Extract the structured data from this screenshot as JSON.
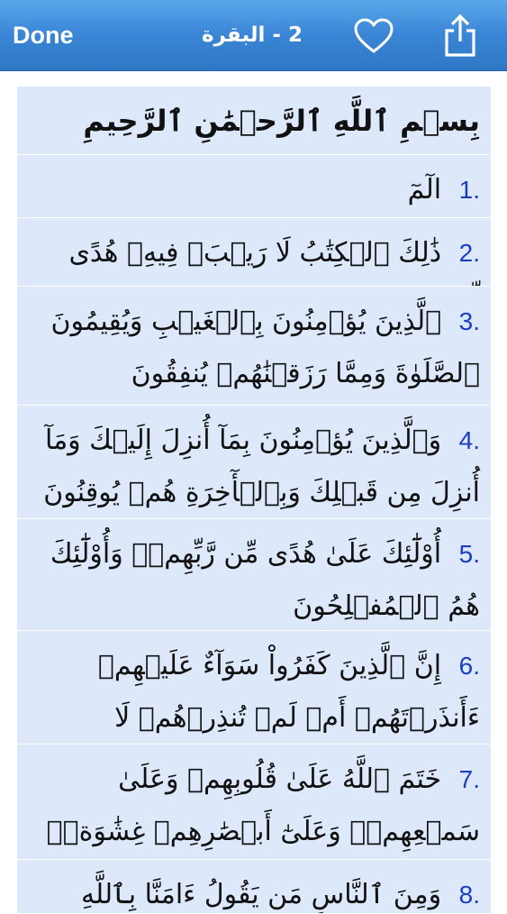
{
  "nav": {
    "done_label": "Done",
    "title": "2 - البقرة",
    "favorite_icon": "heart-outline-icon",
    "share_icon": "share-icon"
  },
  "header": {
    "basmala": "بِسۡمِ ٱللَّهِ ٱلرَّحۡمَٰنِ ٱلرَّحِيمِ"
  },
  "verses": [
    {
      "num": "1.",
      "text": "الٓمٓ"
    },
    {
      "num": "2.",
      "text": "ذَٰلِكَ ٱلۡكِتَٰبُ لَا رَيۡبَۛ فِيهِۛ هُدًى لِّلۡمُتَّقِينَ"
    },
    {
      "num": "3.",
      "text": "ٱلَّذِينَ يُؤۡمِنُونَ بِٱلۡغَيۡبِ وَيُقِيمُونَ ٱلصَّلَوٰةَ وَمِمَّا رَزَقۡنَٰهُمۡ يُنفِقُونَ"
    },
    {
      "num": "4.",
      "text": "وَٱلَّذِينَ يُؤۡمِنُونَ بِمَآ أُنزِلَ إِلَيۡكَ وَمَآ أُنزِلَ مِن قَبۡلِكَ وَبِٱلۡأٓخِرَةِ هُمۡ يُوقِنُونَ"
    },
    {
      "num": "5.",
      "text": "أُوْلَٰٓئِكَ عَلَىٰ هُدًى مِّن رَّبِّهِمۡۖ وَأُوْلَٰٓئِكَ هُمُ ٱلۡمُفۡلِحُونَ"
    },
    {
      "num": "6.",
      "text": "إِنَّ ٱلَّذِينَ كَفَرُواْ سَوَآءٌ عَلَيۡهِمۡ ءَأَنذَرۡتَهُمۡ أَمۡ لَمۡ تُنذِرۡهُمۡ لَا يُؤۡمِنُونَ"
    },
    {
      "num": "7.",
      "text": "خَتَمَ ٱللَّهُ عَلَىٰ قُلُوبِهِمۡ وَعَلَىٰ سَمۡعِهِمۡۖ وَعَلَىٰٓ أَبۡصَٰرِهِمۡ غِشَٰوَةٞۖ وَلَهُمۡ عَذَابٌ عَظِيمٞ"
    },
    {
      "num": "8.",
      "text": "وَمِنَ ٱلنَّاسِ مَن يَقُولُ ءَامَنَّا بِٱللَّهِ"
    }
  ]
}
